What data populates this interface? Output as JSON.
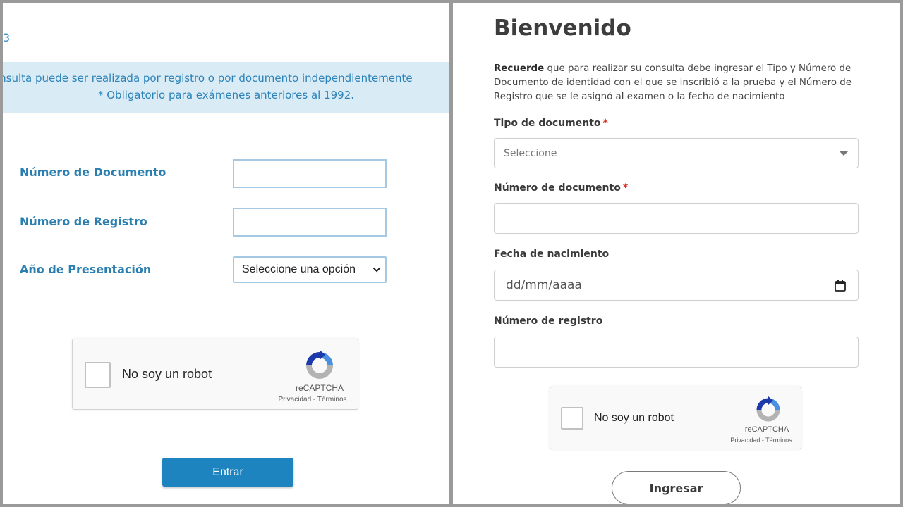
{
  "left_form": {
    "edge_mark": "3",
    "notice_line1": "onsulta puede ser realizada por registro o por documento independientemente",
    "notice_line2": "* Obligatorio para exámenes anteriores al 1992.",
    "fields": {
      "documento_label": "Número de Documento",
      "registro_label": "Número de Registro",
      "anio_label": "Año de Presentación",
      "anio_select_value": "Seleccione una opción"
    },
    "captcha": {
      "label": "No soy un robot",
      "brand": "reCAPTCHA",
      "links": "Privacidad - Términos"
    },
    "submit_label": "Entrar"
  },
  "right_form": {
    "title": "Bienvenido",
    "intro_bold": "Recuerde",
    "intro_text": " que para realizar su consulta debe ingresar el Tipo y Número de Documento de identidad con el que se inscribió a la prueba y el Número de Registro que se le asignó al examen o la fecha de nacimiento",
    "tipo_label": "Tipo de documento",
    "tipo_placeholder": "Seleccione",
    "numero_label": "Número de documento",
    "fecha_label": "Fecha de nacimiento",
    "fecha_placeholder": "dd/mm/aaaa",
    "registro_label": "Número de registro",
    "required_mark": "*",
    "captcha": {
      "label": "No soy un robot",
      "brand": "reCAPTCHA",
      "links": "Privacidad - Términos"
    },
    "submit_label": "Ingresar"
  },
  "colors": {
    "old_accent": "#2a7fb0",
    "old_notice_bg": "#d9ebf5",
    "old_button": "#1e84bf",
    "required": "#d93025",
    "frame": "#9a9a9a"
  }
}
